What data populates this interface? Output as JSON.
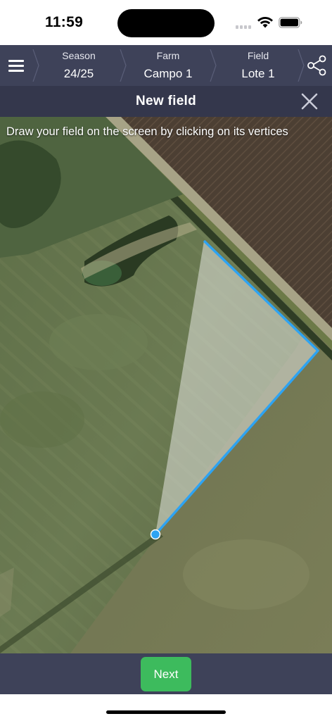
{
  "status_bar": {
    "time": "11:59"
  },
  "topnav": {
    "menu_icon": "hamburger-menu-icon",
    "crumbs": [
      {
        "label": "Season",
        "value": "24/25"
      },
      {
        "label": "Farm",
        "value": "Campo 1"
      },
      {
        "label": "Field",
        "value": "Lote 1"
      }
    ],
    "share_icon": "share-icon"
  },
  "titlebar": {
    "title": "New field",
    "close_icon": "close-icon"
  },
  "map": {
    "instructions": "Draw your field on the screen by clicking on its vertices",
    "polygon_color": "#2ea3f2"
  },
  "bottom": {
    "next_label": "Next",
    "next_color": "#3dbb5d"
  }
}
